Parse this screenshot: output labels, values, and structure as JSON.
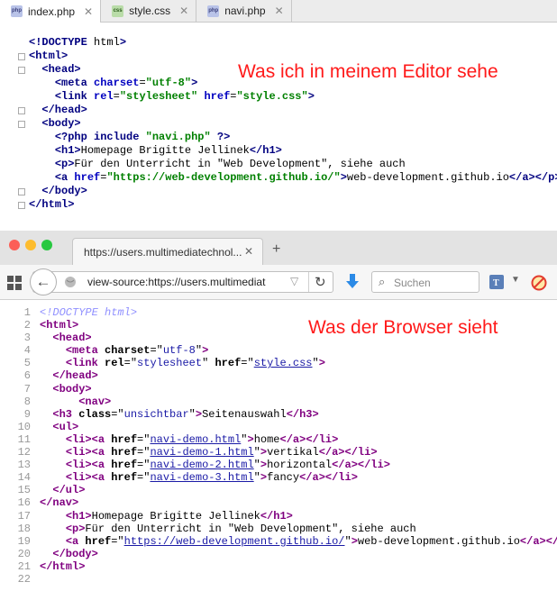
{
  "editor": {
    "tabs": [
      {
        "icon": "php",
        "label": "index.php",
        "active": true
      },
      {
        "icon": "css",
        "label": "style.css",
        "active": false
      },
      {
        "icon": "php",
        "label": "navi.php",
        "active": false
      }
    ],
    "annotation": "Was ich in meinem Editor sehe",
    "lines": [
      "<!DOCTYPE html>",
      "<html>",
      "  <head>",
      "    <meta charset=\"utf-8\">",
      "    <link rel=\"stylesheet\" href=\"style.css\">",
      "  </head>",
      "  <body>",
      "    <?php include \"navi.php\" ?>",
      "    <h1>Homepage Brigitte Jellinek</h1>",
      "    <p>Für den Unterricht in \"Web Development\", siehe auch",
      "    <a href=\"https://web-development.github.io/\">web-development.github.io</a></p>",
      "  </body>",
      "</html>"
    ]
  },
  "browser": {
    "tab_title": "https://users.multimediatechnol...",
    "url": "view-source:https://users.multimediat",
    "search_placeholder": "Suchen",
    "annotation": "Was der Browser sieht",
    "lines": [
      "<!DOCTYPE html>",
      "<html>",
      "  <head>",
      "    <meta charset=\"utf-8\">",
      "    <link rel=\"stylesheet\" href=\"style.css\">",
      "  </head>",
      "  <body>",
      "      <nav>",
      "  <h3 class=\"unsichtbar\">Seitenauswahl</h3>",
      "  <ul>",
      "    <li><a href=\"navi-demo.html\">home</a></li>",
      "    <li><a href=\"navi-demo-1.html\">vertikal</a></li>",
      "    <li><a href=\"navi-demo-2.html\">horizontal</a></li>",
      "    <li><a href=\"navi-demo-3.html\">fancy</a></li>",
      "  </ul>",
      "</nav>",
      "    <h1>Homepage Brigitte Jellinek</h1>",
      "    <p>Für den Unterricht in \"Web Development\", siehe auch",
      "    <a href=\"https://web-development.github.io/\">web-development.github.io</a></p>",
      "  </body>",
      "</html>",
      ""
    ]
  }
}
